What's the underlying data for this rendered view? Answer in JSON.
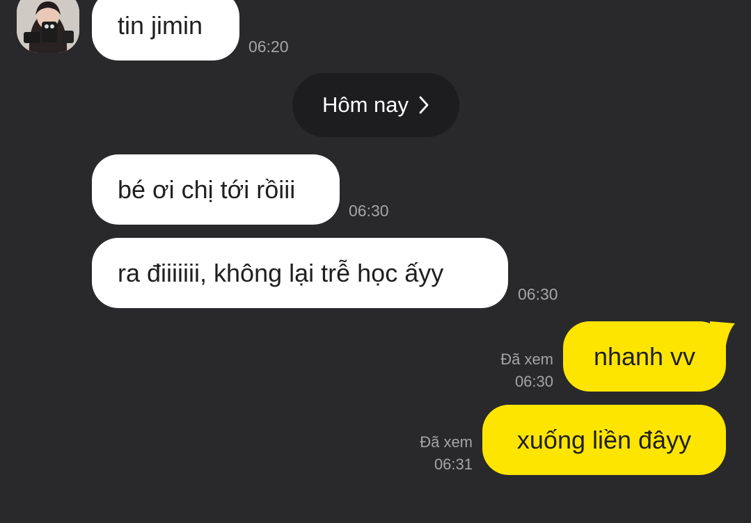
{
  "chat": {
    "incoming": [
      {
        "text": "tin jimin",
        "time": "06:20"
      },
      {
        "text": "bé ơi chị tới rồiii",
        "time": "06:30"
      },
      {
        "text": "ra điiiiiii, không lại trễ học ấyy",
        "time": "06:30"
      }
    ],
    "date_divider": {
      "label": "Hôm nay",
      "icon": "chevron-right-icon"
    },
    "outgoing": [
      {
        "text": "nhanh vv",
        "status": "Đã xem",
        "time": "06:30"
      },
      {
        "text": "xuống liền đâyy",
        "status": "Đã xem",
        "time": "06:31"
      }
    ]
  },
  "colors": {
    "background": "#29292b",
    "incoming_bubble": "#ffffff",
    "outgoing_bubble": "#fee500",
    "date_pill": "#1d1d1f",
    "meta_text": "#a5a5a8"
  }
}
